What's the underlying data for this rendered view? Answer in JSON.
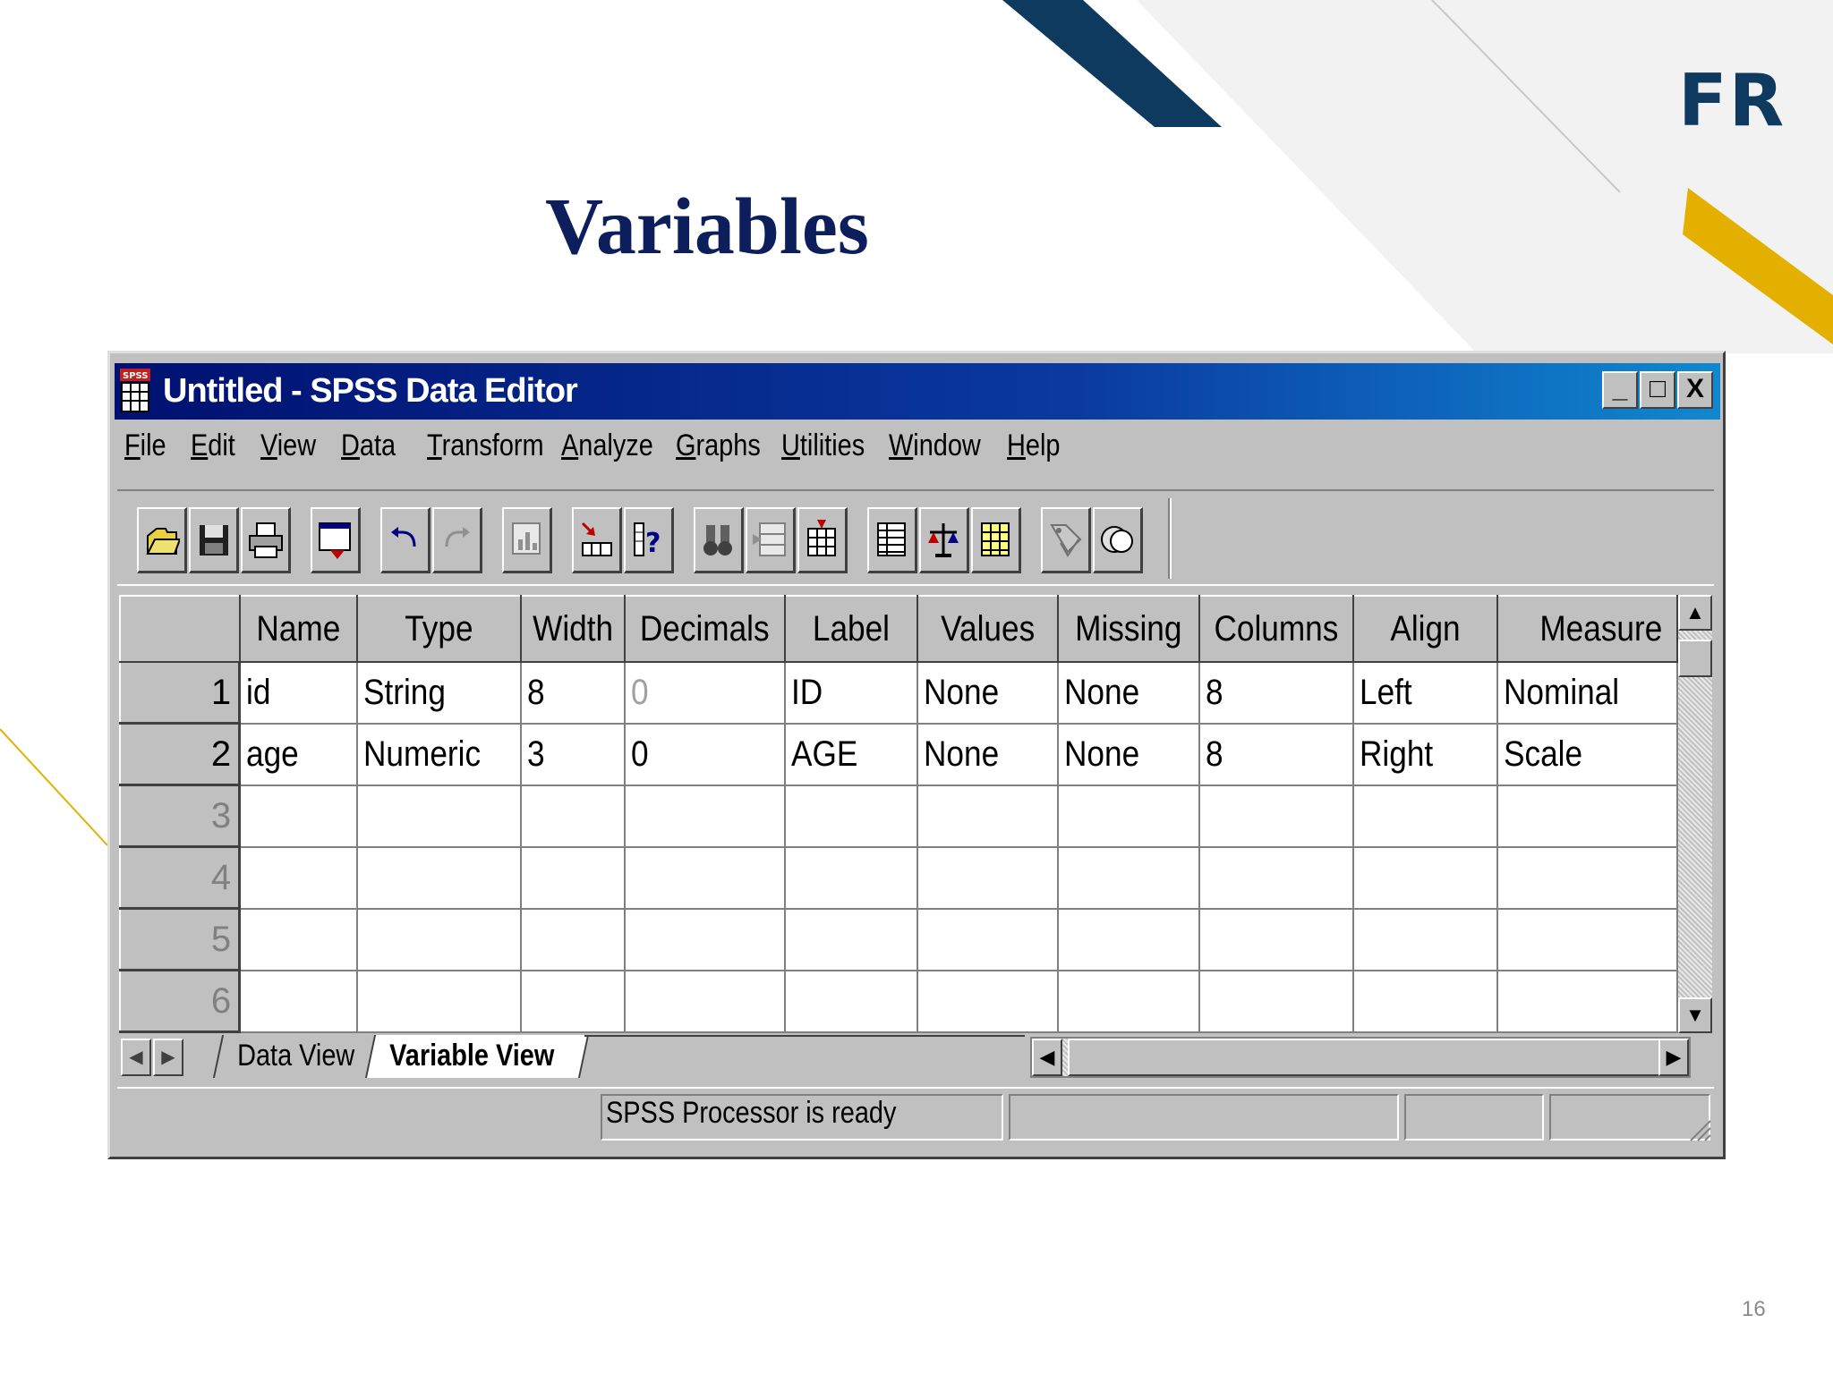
{
  "slide": {
    "brand": "FR",
    "title": "Variables",
    "page_number": "16",
    "colors": {
      "navy": "#0e3a5f",
      "gold": "#e4b000",
      "title": "#0c1f5c"
    }
  },
  "window": {
    "title": "Untitled - SPSS Data Editor",
    "app_icon": "spss-icon",
    "controls": {
      "minimize": "_",
      "maximize": "□",
      "close": "X"
    }
  },
  "menu": [
    "File",
    "Edit",
    "View",
    "Data",
    "Transform",
    "Analyze",
    "Graphs",
    "Utilities",
    "Window",
    "Help"
  ],
  "toolbar": [
    "open-file-icon",
    "save-icon",
    "print-icon",
    "dialog-recall-icon",
    "undo-icon",
    "redo-icon",
    "goto-chart-icon",
    "goto-case-icon",
    "variables-info-icon",
    "find-icon",
    "insert-case-icon",
    "insert-variable-icon",
    "split-file-icon",
    "weight-cases-icon",
    "select-cases-icon",
    "value-labels-icon",
    "use-sets-icon"
  ],
  "grid": {
    "columns": [
      "Name",
      "Type",
      "Width",
      "Decimals",
      "Label",
      "Values",
      "Missing",
      "Columns",
      "Align",
      "Measure"
    ],
    "rows": [
      {
        "num": "1",
        "cells": [
          "id",
          "String",
          "8",
          "0",
          "ID",
          "None",
          "None",
          "8",
          "Left",
          "Nominal"
        ]
      },
      {
        "num": "2",
        "cells": [
          "age",
          "Numeric",
          "3",
          "0",
          "AGE",
          "None",
          "None",
          "8",
          "Right",
          "Scale"
        ]
      },
      {
        "num": "3",
        "cells": [
          "",
          "",
          "",
          "",
          "",
          "",
          "",
          "",
          "",
          ""
        ]
      },
      {
        "num": "4",
        "cells": [
          "",
          "",
          "",
          "",
          "",
          "",
          "",
          "",
          "",
          ""
        ]
      },
      {
        "num": "5",
        "cells": [
          "",
          "",
          "",
          "",
          "",
          "",
          "",
          "",
          "",
          ""
        ]
      },
      {
        "num": "6",
        "cells": [
          "",
          "",
          "",
          "",
          "",
          "",
          "",
          "",
          "",
          ""
        ]
      }
    ]
  },
  "tabs": {
    "data_view": "Data View",
    "variable_view": "Variable View",
    "active": "Variable View"
  },
  "status": {
    "message": "SPSS Processor  is ready"
  }
}
